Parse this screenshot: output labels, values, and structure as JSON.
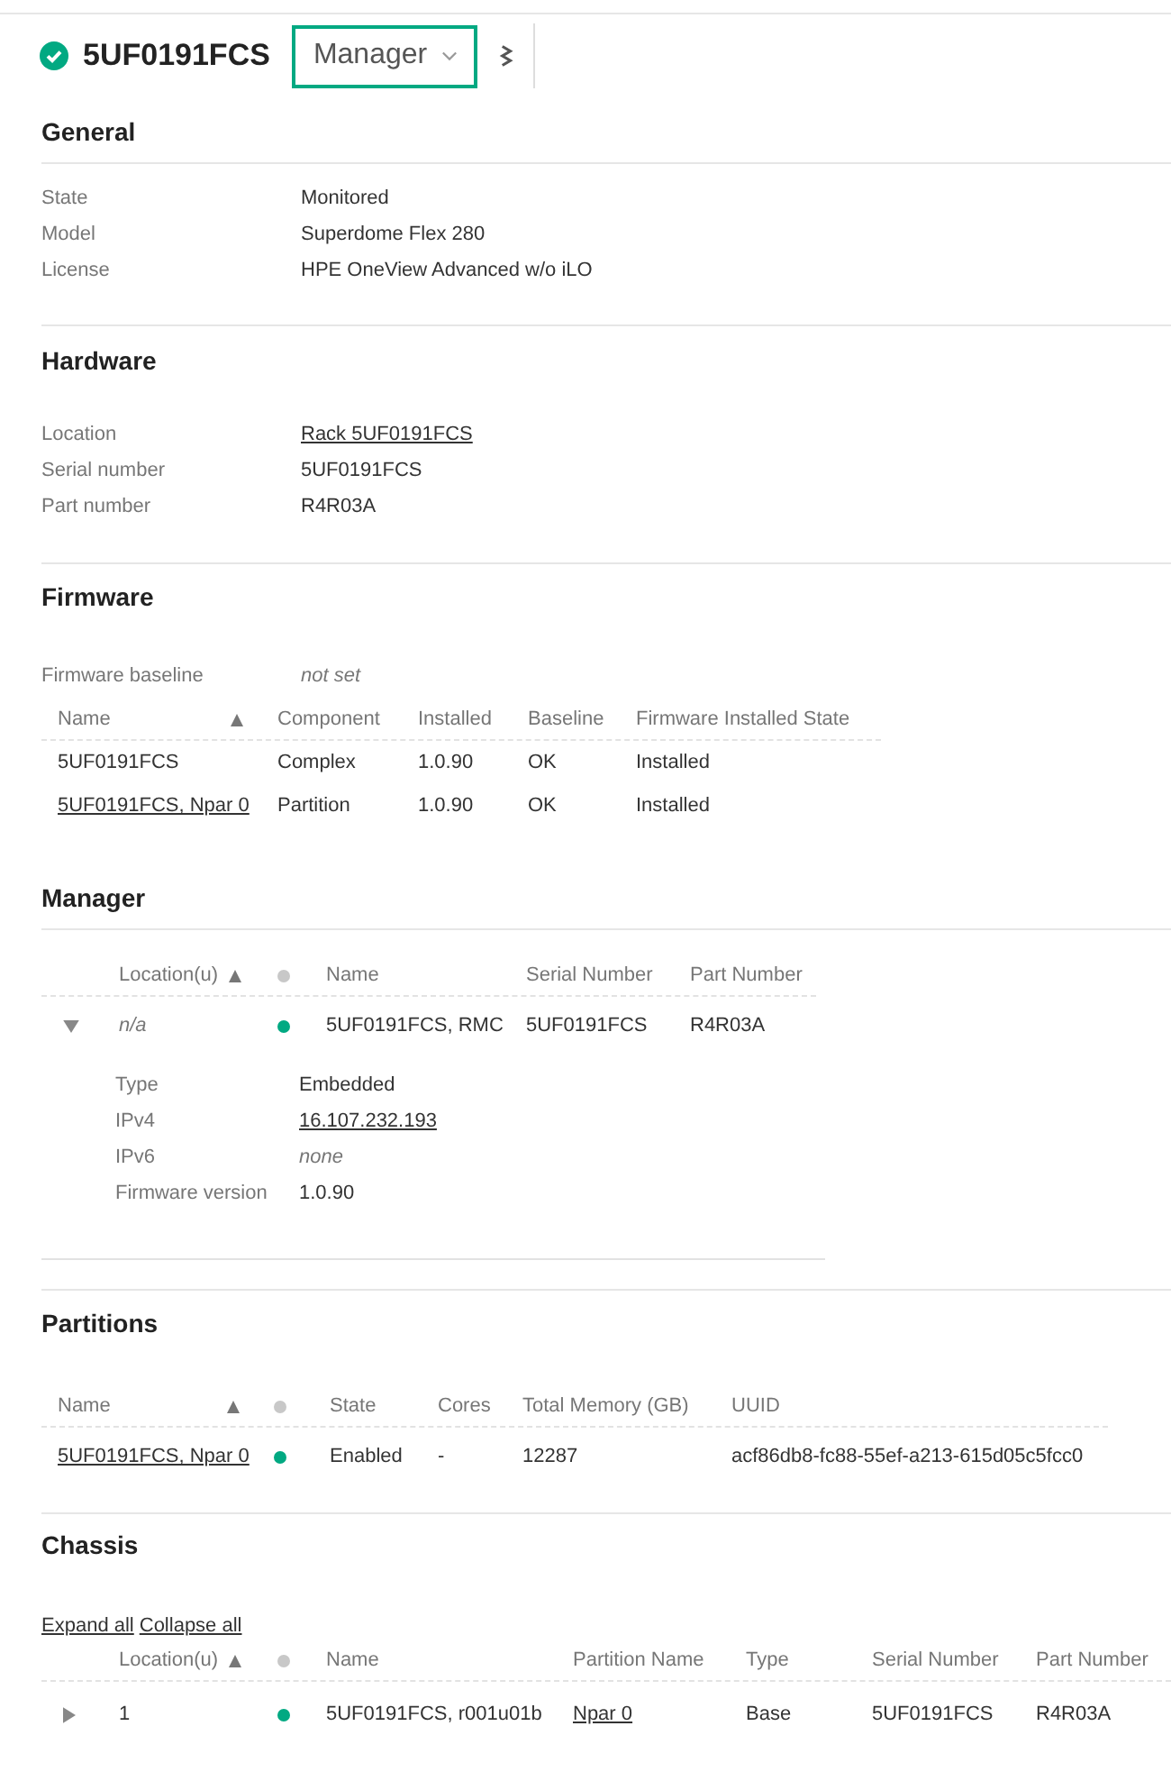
{
  "header": {
    "title": "5UF0191FCS",
    "view_selector": "Manager"
  },
  "sections": [
    {
      "title": "General",
      "fields": [
        {
          "label": "State",
          "value": "Monitored",
          "kind": "plain"
        },
        {
          "label": "Model",
          "value": "Superdome Flex 280",
          "kind": "plain"
        },
        {
          "label": "License",
          "value": "HPE OneView Advanced w/o iLO",
          "kind": "plain"
        }
      ]
    },
    {
      "title": "Hardware",
      "fields": [
        {
          "label": "Location",
          "value": "Rack 5UF0191FCS",
          "kind": "link"
        },
        {
          "label": "Serial number",
          "value": "5UF0191FCS",
          "kind": "plain"
        },
        {
          "label": "Part number",
          "value": "R4R03A",
          "kind": "plain"
        }
      ]
    },
    {
      "title": "Firmware",
      "fields": [
        {
          "label": "Firmware baseline",
          "value": "not set",
          "kind": "muted"
        }
      ],
      "table": {
        "columns": [
          {
            "kind": "text",
            "label": "Name",
            "sorted": true
          },
          {
            "kind": "text",
            "label": "Component",
            "sorted": false
          },
          {
            "kind": "text",
            "label": "Installed",
            "sorted": false
          },
          {
            "kind": "text",
            "label": "Baseline",
            "sorted": false
          },
          {
            "kind": "text",
            "label": "Firmware Installed State",
            "sorted": false
          }
        ],
        "rows": [
          {
            "cells": [
              {
                "text": "5UF0191FCS",
                "kind": "plain"
              },
              {
                "text": "Complex",
                "kind": "plain"
              },
              {
                "text": "1.0.90",
                "kind": "plain"
              },
              {
                "text": "OK",
                "kind": "plain"
              },
              {
                "text": "Installed",
                "kind": "plain"
              }
            ]
          },
          {
            "cells": [
              {
                "text": "5UF0191FCS, Npar 0",
                "kind": "link"
              },
              {
                "text": "Partition",
                "kind": "plain"
              },
              {
                "text": "1.0.90",
                "kind": "plain"
              },
              {
                "text": "OK",
                "kind": "plain"
              },
              {
                "text": "Installed",
                "kind": "plain"
              }
            ]
          }
        ]
      }
    },
    {
      "title": "Manager",
      "table": {
        "columns": [
          {
            "kind": "expander"
          },
          {
            "kind": "text",
            "label": "Location(u)",
            "sorted": true
          },
          {
            "kind": "status"
          },
          {
            "kind": "text",
            "label": "Name",
            "sorted": false
          },
          {
            "kind": "text",
            "label": "Serial Number",
            "sorted": false
          },
          {
            "kind": "text",
            "label": "Part Number",
            "sorted": false
          }
        ],
        "rows": [
          {
            "expanded": true,
            "color": "#01a982",
            "cells": [
              {
                "text": ""
              },
              {
                "text": "n/a",
                "kind": "muted"
              },
              {
                "text": ""
              },
              {
                "text": "5UF0191FCS, RMC",
                "kind": "plain"
              },
              {
                "text": "5UF0191FCS",
                "kind": "plain"
              },
              {
                "text": "R4R03A",
                "kind": "plain"
              }
            ],
            "details": [
              {
                "label": "Type",
                "value": "Embedded",
                "kind": "plain"
              },
              {
                "label": "IPv4",
                "value": "16.107.232.193",
                "kind": "link"
              },
              {
                "label": "IPv6",
                "value": "none",
                "kind": "muted"
              },
              {
                "label": "Firmware version",
                "value": "1.0.90",
                "kind": "plain"
              }
            ]
          }
        ]
      }
    },
    {
      "title": "Partitions",
      "table": {
        "columns": [
          {
            "kind": "text",
            "label": "Name",
            "sorted": true
          },
          {
            "kind": "status"
          },
          {
            "kind": "text",
            "label": "State",
            "sorted": false
          },
          {
            "kind": "text",
            "label": "Cores",
            "sorted": false
          },
          {
            "kind": "text",
            "label": "Total Memory (GB)",
            "sorted": false
          },
          {
            "kind": "text",
            "label": "UUID",
            "sorted": false
          }
        ],
        "rows": [
          {
            "color": "#01a982",
            "cells": [
              {
                "text": "5UF0191FCS, Npar 0",
                "kind": "link"
              },
              {
                "text": ""
              },
              {
                "text": "Enabled",
                "kind": "plain"
              },
              {
                "text": "-",
                "kind": "plain"
              },
              {
                "text": "12287",
                "kind": "plain"
              },
              {
                "text": "acf86db8-fc88-55ef-a213-615d05c5fcc0",
                "kind": "plain"
              }
            ]
          }
        ]
      }
    },
    {
      "title": "Chassis",
      "actions": [
        "Expand all",
        "Collapse all"
      ],
      "table": {
        "columns": [
          {
            "kind": "expander"
          },
          {
            "kind": "text",
            "label": "Location(u)",
            "sorted": true
          },
          {
            "kind": "status"
          },
          {
            "kind": "text",
            "label": "Name",
            "sorted": false
          },
          {
            "kind": "text",
            "label": "Partition Name",
            "sorted": false
          },
          {
            "kind": "text",
            "label": "Type",
            "sorted": false
          },
          {
            "kind": "text",
            "label": "Serial Number",
            "sorted": false
          },
          {
            "kind": "text",
            "label": "Part Number",
            "sorted": false
          }
        ],
        "rows": [
          {
            "expanded": false,
            "color": "#01a982",
            "cells": [
              {
                "text": ""
              },
              {
                "text": "1",
                "kind": "plain"
              },
              {
                "text": ""
              },
              {
                "text": "5UF0191FCS, r001u01b",
                "kind": "plain"
              },
              {
                "text": "Npar 0",
                "kind": "link"
              },
              {
                "text": "Base",
                "kind": "plain"
              },
              {
                "text": "5UF0191FCS",
                "kind": "plain"
              },
              {
                "text": "R4R03A",
                "kind": "plain"
              }
            ]
          }
        ]
      }
    }
  ]
}
